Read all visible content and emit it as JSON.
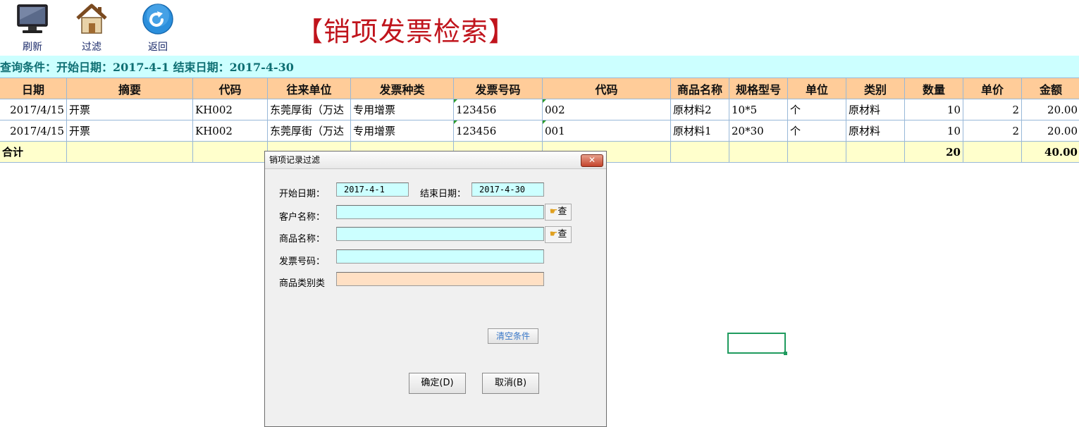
{
  "toolbar": {
    "refresh_label": "刷新",
    "filter_label": "过滤",
    "back_label": "返回"
  },
  "page_title": "【销项发票检索】",
  "condition_text": "查询条件：开始日期：2017-4-1 结束日期：2017-4-30",
  "table": {
    "headers": [
      "日期",
      "摘要",
      "代码",
      "往来单位",
      "发票种类",
      "发票号码",
      "代码",
      "商品名称",
      "规格型号",
      "单位",
      "类别",
      "数量",
      "单价",
      "金额"
    ],
    "rows": [
      [
        "2017/4/15",
        "开票",
        "KH002",
        "东莞厚街（万达",
        "专用增票",
        "123456",
        "002",
        "原材料2",
        "10*5",
        "个",
        "原材料",
        "10",
        "2",
        "20.00"
      ],
      [
        "2017/4/15",
        "开票",
        "KH002",
        "东莞厚街（万达",
        "专用增票",
        "123456",
        "001",
        "原材料1",
        "20*30",
        "个",
        "原材料",
        "10",
        "2",
        "20.00"
      ]
    ],
    "total": {
      "label": "合计",
      "quantity": "20",
      "amount": "40.00"
    }
  },
  "dialog": {
    "title": "销项记录过滤",
    "close_label": "✕",
    "start_date_label": "开始日期：",
    "start_date_value": "2017-4-1",
    "end_date_label": "结束日期：",
    "end_date_value": "2017-4-30",
    "customer_label": "客户名称：",
    "customer_value": "",
    "product_label": "商品名称：",
    "product_value": "",
    "invoice_no_label": "发票号码：",
    "invoice_no_value": "",
    "category_label": "商品类别类",
    "category_value": "",
    "query_btn_label": "查",
    "clear_btn_label": "清空条件",
    "ok_btn_label": "确定(D)",
    "cancel_btn_label": "取消(B)"
  }
}
